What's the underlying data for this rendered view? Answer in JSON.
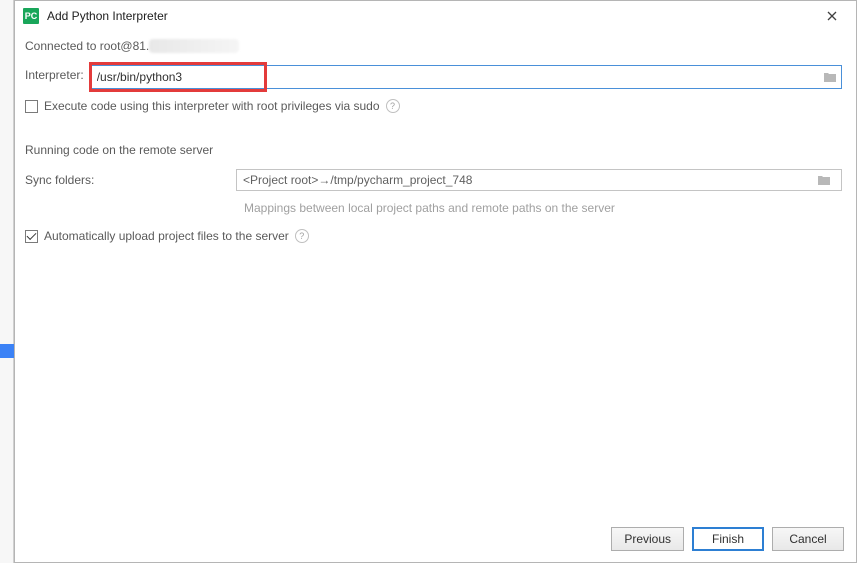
{
  "window": {
    "title": "Add Python Interpreter"
  },
  "connection": {
    "prefix": "Connected to root@81."
  },
  "interpreter": {
    "label": "Interpreter:",
    "value": "/usr/bin/python3"
  },
  "exec_sudo": {
    "label": "Execute code using this interpreter with root privileges via sudo",
    "checked": false
  },
  "section_title": "Running code on the remote server",
  "sync": {
    "label": "Sync folders:",
    "value": "<Project root>→/tmp/pycharm_project_748",
    "hint": "Mappings between local project paths and remote paths on the server"
  },
  "auto_upload": {
    "label": "Automatically upload project files to the server",
    "checked": true
  },
  "buttons": {
    "previous": "Previous",
    "finish": "Finish",
    "cancel": "Cancel"
  }
}
